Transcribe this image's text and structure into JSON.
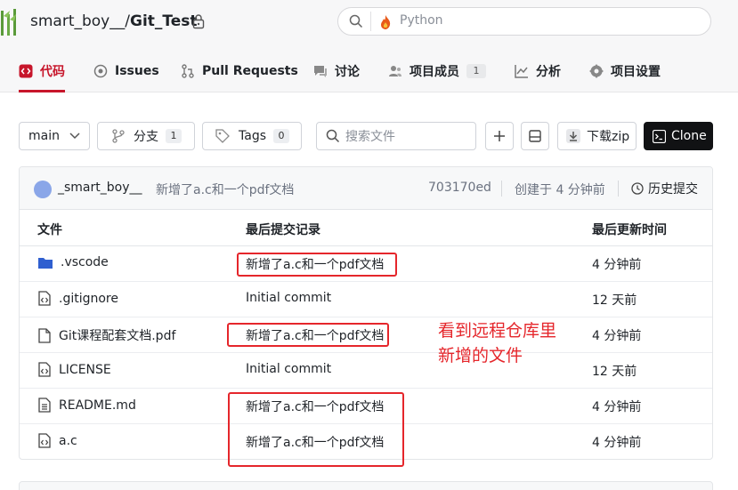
{
  "header": {
    "owner": "smart_boy__",
    "slash": "/",
    "repo": "Git_Test",
    "search_placeholder": "Python"
  },
  "tabs": [
    {
      "label": "代码",
      "icon": "code-icon",
      "active": true
    },
    {
      "label": "Issues",
      "icon": "issue-icon"
    },
    {
      "label": "Pull Requests",
      "icon": "pull-request-icon"
    },
    {
      "label": "讨论",
      "icon": "discussion-icon"
    },
    {
      "label": "项目成员",
      "icon": "members-icon",
      "badge": "1"
    },
    {
      "label": "分析",
      "icon": "chart-icon"
    },
    {
      "label": "项目设置",
      "icon": "gear-icon"
    }
  ],
  "toolbar": {
    "branch": "main",
    "branches_label": "分支",
    "branches_count": "1",
    "tags_label": "Tags",
    "tags_count": "0",
    "search_files_placeholder": "搜索文件",
    "download_label": "下载zip",
    "clone_label": "Clone"
  },
  "commit": {
    "author": "_smart_boy__",
    "message": "新增了a.c和一个pdf文档",
    "sha": "703170ed",
    "time": "创建于 4 分钟前",
    "history_label": "历史提交"
  },
  "table": {
    "columns": [
      "文件",
      "最后提交记录",
      "最后更新时间"
    ],
    "rows": [
      {
        "name": ".vscode",
        "icon": "folder-icon",
        "message": "新增了a.c和一个pdf文档",
        "time": "4 分钟前"
      },
      {
        "name": ".gitignore",
        "icon": "code-file-icon",
        "message": "Initial commit",
        "time": "12 天前"
      },
      {
        "name": "Git课程配套文档.pdf",
        "icon": "file-icon",
        "message": "新增了a.c和一个pdf文档",
        "time": "4 分钟前"
      },
      {
        "name": "LICENSE",
        "icon": "code-file-icon",
        "message": "Initial commit",
        "time": "12 天前"
      },
      {
        "name": "README.md",
        "icon": "doc-file-icon",
        "message": "新增了a.c和一个pdf文档",
        "time": "4 分钟前"
      },
      {
        "name": "a.c",
        "icon": "code-file-icon",
        "message": "新增了a.c和一个pdf文档",
        "time": "4 分钟前"
      }
    ]
  },
  "annotation": {
    "line1": "看到远程仓库里",
    "line2": "新增的文件",
    "color": "#e5262b"
  },
  "colors": {
    "accent": "#c7162b",
    "clone_bg": "#111214",
    "folder": "#2f5fd0"
  }
}
